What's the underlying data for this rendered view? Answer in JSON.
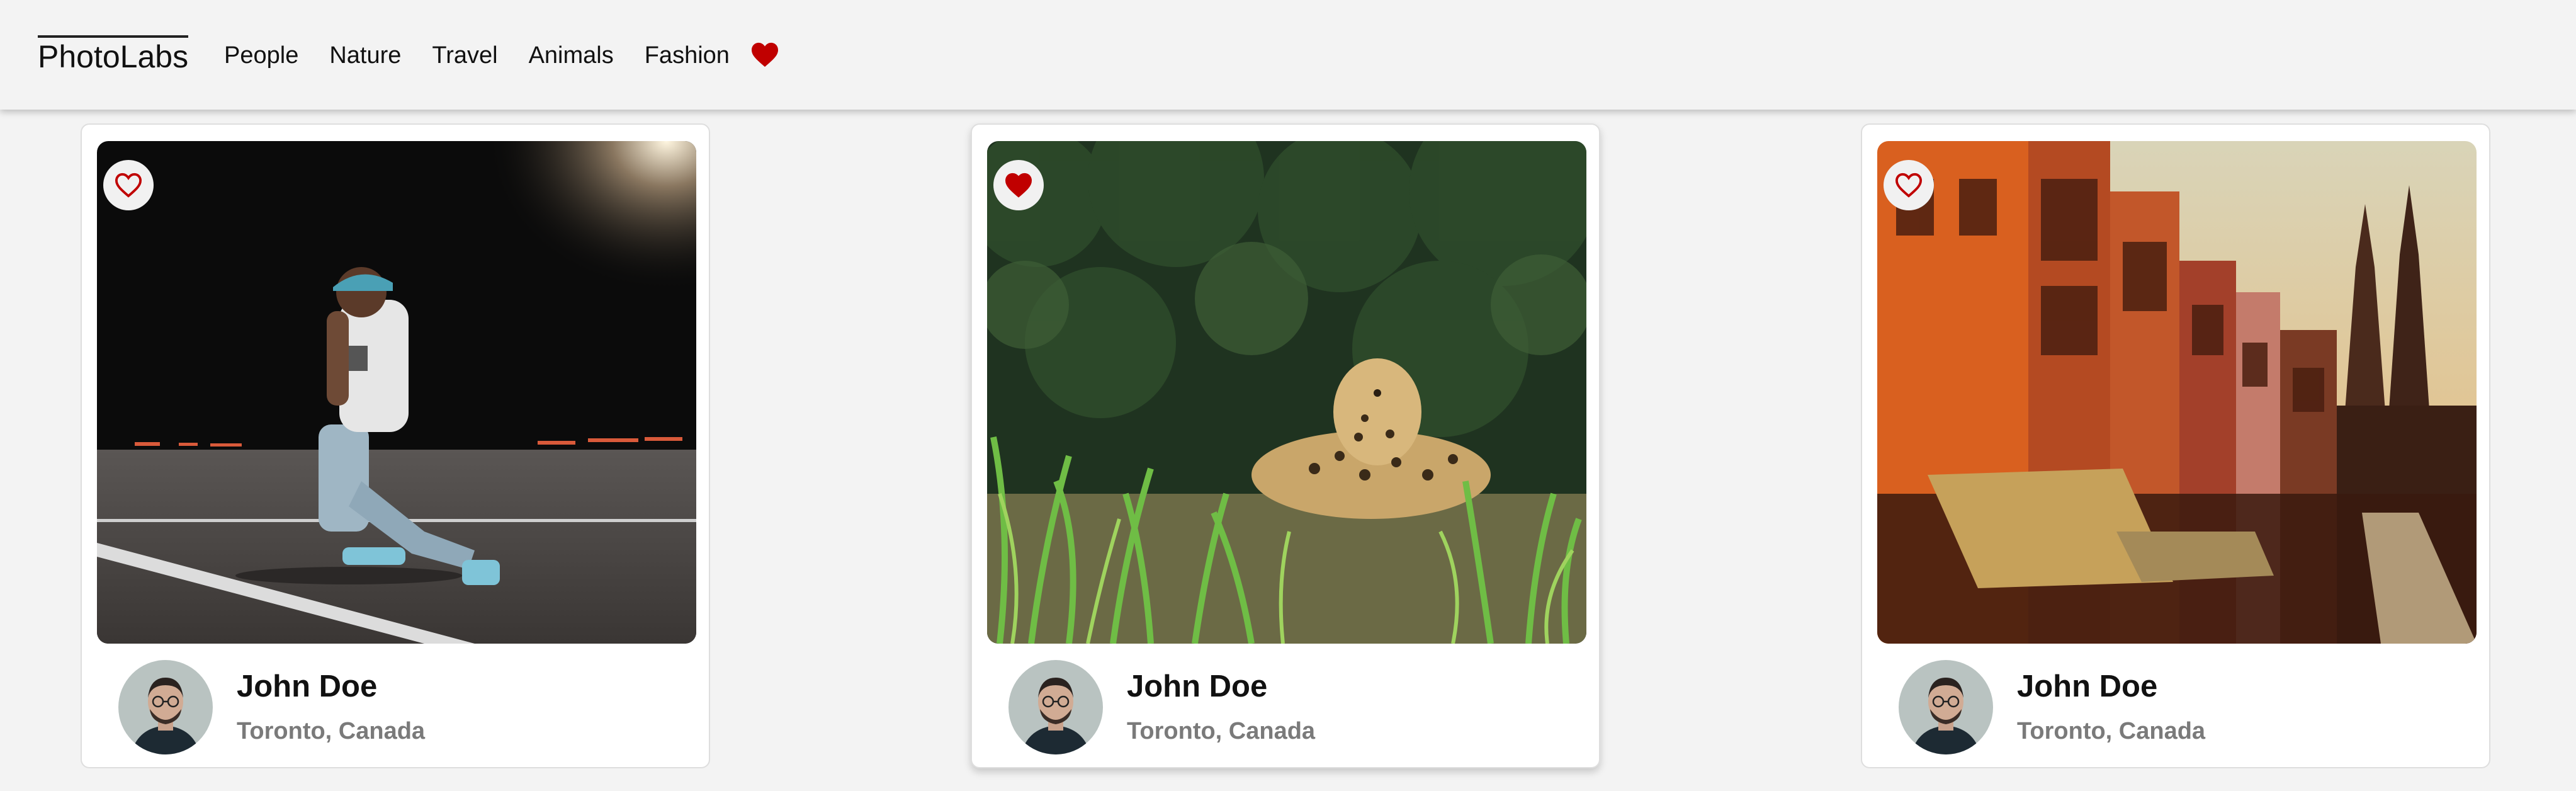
{
  "nav": {
    "logo": "PhotoLabs",
    "topics": [
      "People",
      "Nature",
      "Travel",
      "Animals",
      "Fashion"
    ],
    "fav_badge_icon": "heart-icon",
    "fav_badge_color": "#c00000"
  },
  "photos": [
    {
      "subject": "person-walking-street-night",
      "liked": false,
      "user": {
        "name": "John Doe",
        "location": "Toronto, Canada"
      }
    },
    {
      "subject": "leopard-in-grass",
      "liked": true,
      "user": {
        "name": "John Doe",
        "location": "Toronto, Canada"
      }
    },
    {
      "subject": "colorful-buildings-with-church-spires",
      "liked": false,
      "user": {
        "name": "John Doe",
        "location": "Toronto, Canada"
      }
    }
  ],
  "colors": {
    "like_red": "#c00000",
    "background": "#f3f3f3",
    "location_gray": "#7a7a7a"
  }
}
